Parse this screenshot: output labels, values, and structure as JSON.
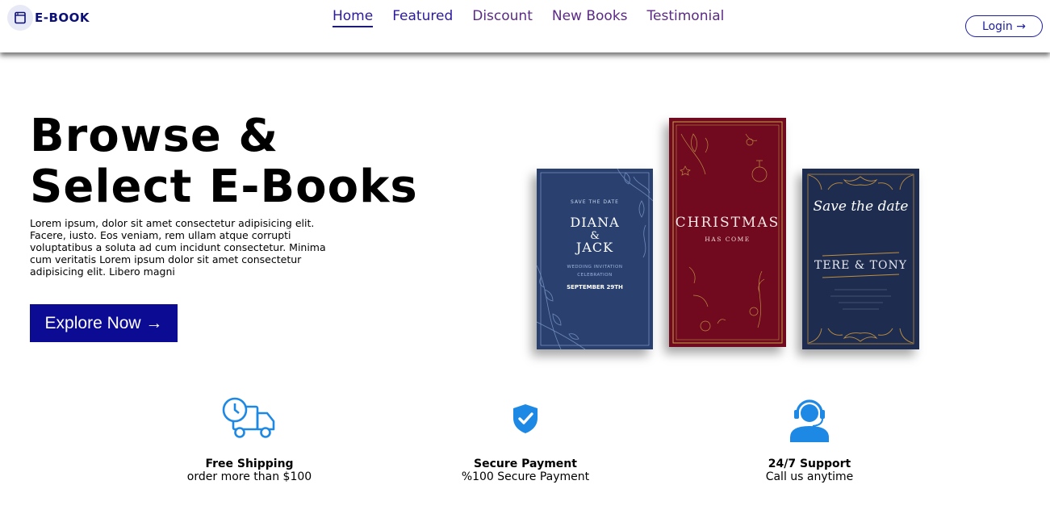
{
  "header": {
    "logo_text": "E-BOOK",
    "logo_icon": "book-icon",
    "nav": [
      {
        "label": "Home",
        "active": true
      },
      {
        "label": "Featured",
        "active": false
      },
      {
        "label": "Discount",
        "active": false
      },
      {
        "label": "New Books",
        "active": false
      },
      {
        "label": "Testimonial",
        "active": false
      }
    ],
    "login_label": "Login →"
  },
  "hero": {
    "title_line1": "Browse &",
    "title_line2": "Select E-Books",
    "description": "Lorem ipsum, dolor sit amet consectetur adipisicing elit. Facere, iusto. Eos veniam, rem ullam atque corrupti voluptatibus a soluta ad cum incidunt consectetur. Minima cum veritatis Lorem ipsum dolor sit amet consectetur adipisicing elit. Libero magni",
    "cta_label": "Explore Now →"
  },
  "books": [
    {
      "top_small": "SAVE THE DATE",
      "name1": "DIANA",
      "amp": "&",
      "name2": "JACK",
      "sub1": "WEDDING INVITATION",
      "sub2": "CELEBRATION",
      "date": "SEPTEMBER 29TH"
    },
    {
      "title": "CHRISTMAS",
      "subtitle": "HAS COME"
    },
    {
      "script": "Save the date",
      "names": "TERE & TONY"
    }
  ],
  "features": [
    {
      "icon": "delivery-truck-clock-icon",
      "title": "Free Shipping",
      "subtitle": "order more than $100"
    },
    {
      "icon": "shield-check-icon",
      "title": "Secure Payment",
      "subtitle": "%100 Secure Payment"
    },
    {
      "icon": "headset-support-icon",
      "title": "24/7 Support",
      "subtitle": "Call us anytime"
    }
  ],
  "colors": {
    "brand_navy": "#0c1076",
    "cta_blue": "#0c0b94",
    "nav_purple": "#5b2a86",
    "icon_blue": "#1e88e5"
  }
}
